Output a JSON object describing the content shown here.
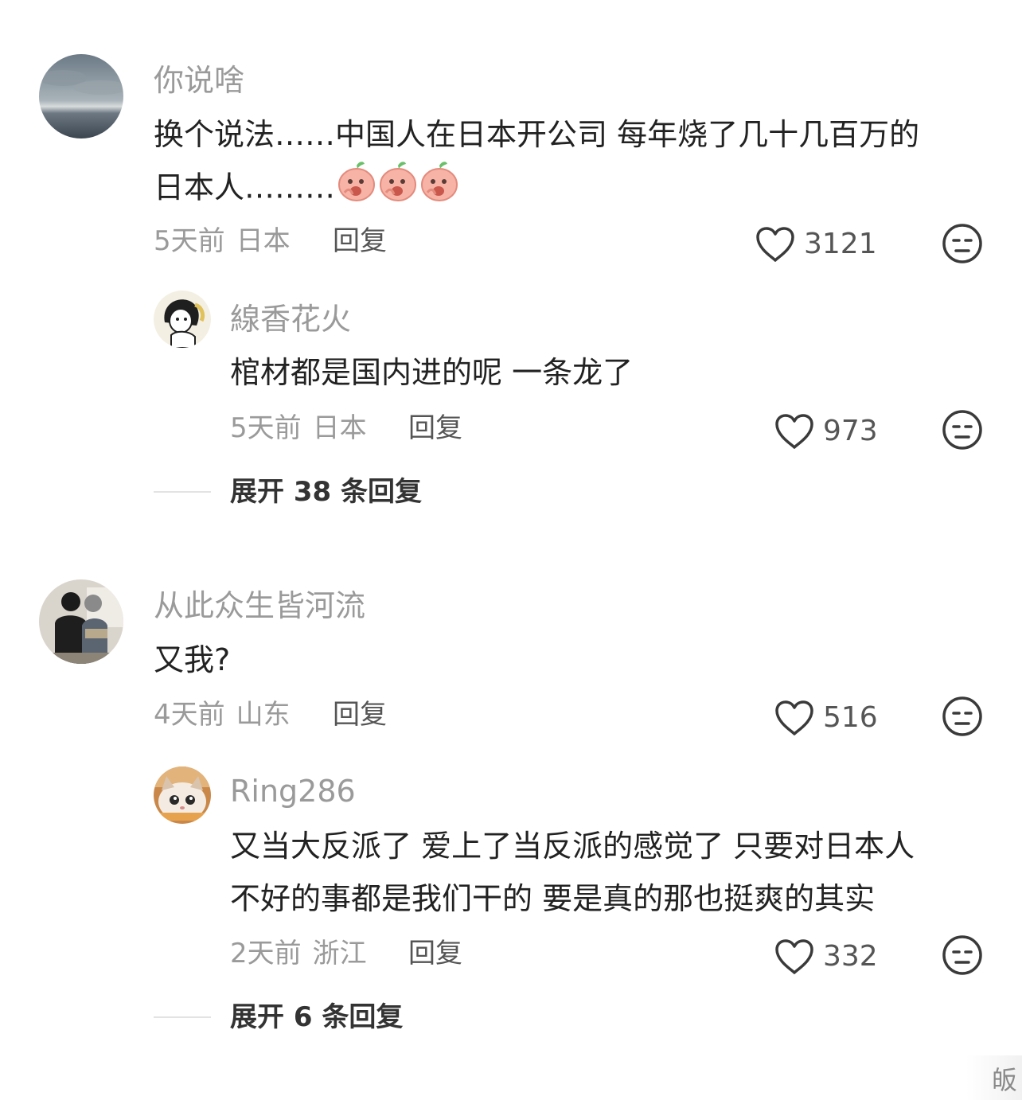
{
  "comments": [
    {
      "username": "你说啥",
      "text_line1": "换个说法……中国人在日本开公司 每年烧了几十几百万的",
      "text_line2": "日本人………",
      "emoji_icons": [
        "peach-face-icon",
        "peach-face-icon",
        "peach-face-icon"
      ],
      "time": "5天前",
      "location": "日本",
      "reply_label": "回复",
      "likes": "3121",
      "reply": {
        "username": "線香花火",
        "text": "棺材都是国内进的呢 一条龙了",
        "time": "5天前",
        "location": "日本",
        "reply_label": "回复",
        "likes": "973"
      },
      "expand_label": "展开 38 条回复"
    },
    {
      "username": "从此众生皆河流",
      "text_line1": "又我?",
      "time": "4天前",
      "location": "山东",
      "reply_label": "回复",
      "likes": "516",
      "reply": {
        "username": "Ring286",
        "text_line1": "又当大反派了 爱上了当反派的感觉了 只要对日本人",
        "text_line2": "不好的事都是我们干的 要是真的那也挺爽的其实",
        "time": "2天前",
        "location": "浙江",
        "reply_label": "回复",
        "likes": "332"
      },
      "expand_label": "展开 6 条回复"
    }
  ],
  "icons": {
    "like": "heart-outline-icon",
    "dislike": "neutral-face-icon"
  },
  "watermark_char": "皈"
}
